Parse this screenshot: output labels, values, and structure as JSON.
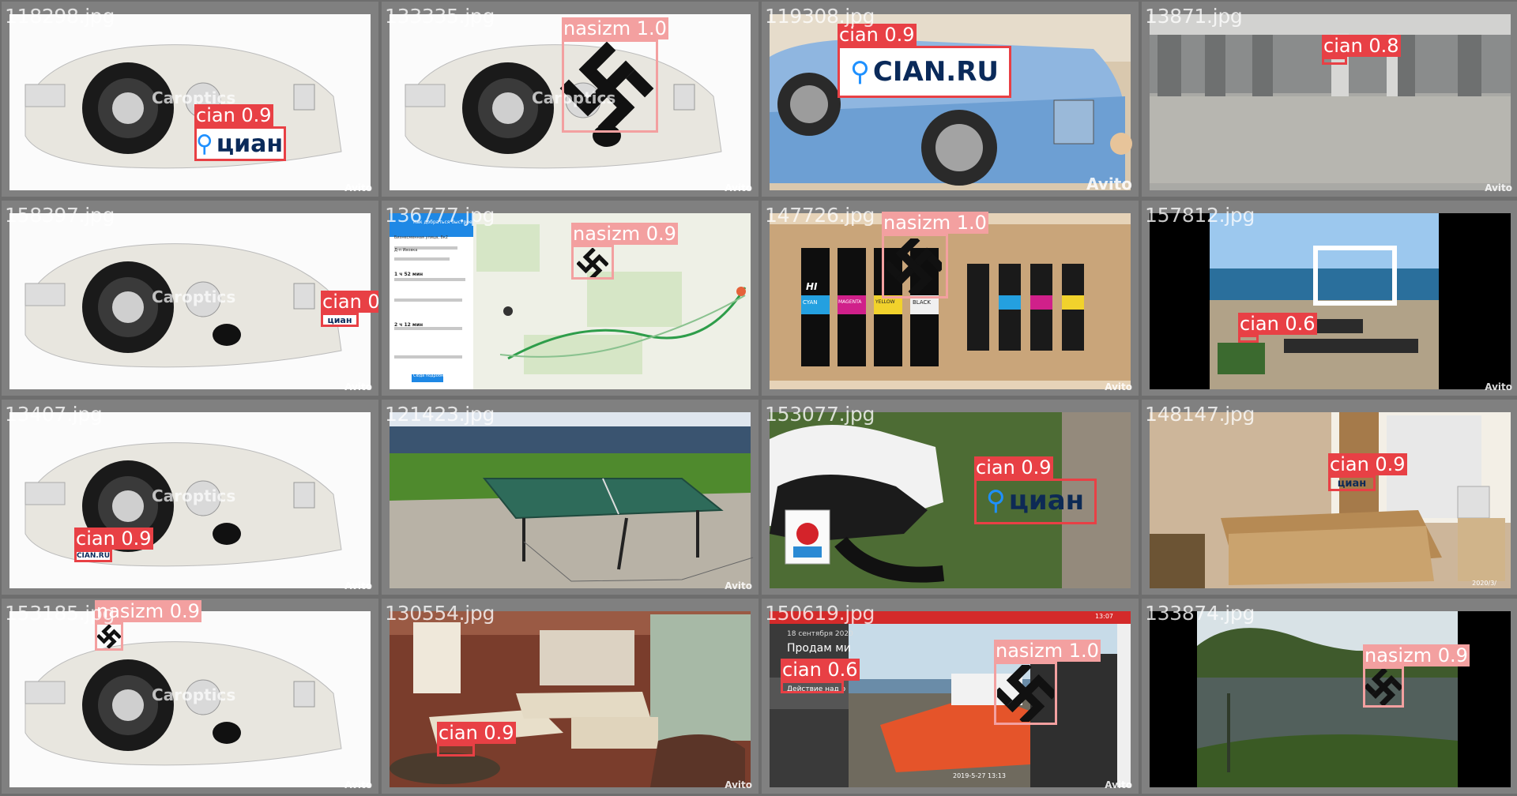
{
  "tiles": [
    {
      "filename": "118298.jpg",
      "scene": "headlight",
      "watermark": "Avito",
      "carparts": "Caroptics",
      "dets": [
        {
          "label": "cian 0.9",
          "cls": "cian"
        }
      ],
      "logo_text": "циан"
    },
    {
      "filename": "133335.jpg",
      "scene": "headlight",
      "watermark": "Avito",
      "carparts": "Caroptics",
      "dets": [
        {
          "label": "nasizm 1.0",
          "cls": "nasizm"
        }
      ]
    },
    {
      "filename": "119308.jpg",
      "scene": "bed",
      "watermark": "Avito",
      "dets": [
        {
          "label": "cian 0.9",
          "cls": "cian"
        }
      ],
      "logo_text": "CIAN.RU"
    },
    {
      "filename": "13871.jpg",
      "scene": "warehouse",
      "watermark": "Avito",
      "dets": [
        {
          "label": "cian 0.8",
          "cls": "cian"
        }
      ]
    },
    {
      "filename": "158397.jpg",
      "scene": "headlight",
      "watermark": "Avito",
      "carparts": "Caroptics",
      "dets": [
        {
          "label": "cian 0.9",
          "cls": "cian"
        }
      ],
      "logo_text": "циан"
    },
    {
      "filename": "136777.jpg",
      "scene": "map",
      "watermark": "",
      "dets": [
        {
          "label": "nasizm 0.9",
          "cls": "nasizm"
        }
      ]
    },
    {
      "filename": "147726.jpg",
      "scene": "ink",
      "watermark": "Avito",
      "dets": [
        {
          "label": "nasizm 1.0",
          "cls": "nasizm"
        }
      ]
    },
    {
      "filename": "157812.jpg",
      "scene": "seaside",
      "watermark": "Avito",
      "dets": [
        {
          "label": "cian 0.6",
          "cls": "cian"
        }
      ]
    },
    {
      "filename": "13407.jpg",
      "scene": "headlight",
      "watermark": "Avito",
      "carparts": "Caroptics",
      "dets": [
        {
          "label": "cian 0.9",
          "cls": "cian"
        }
      ],
      "logo_text": "CIAN.RU"
    },
    {
      "filename": "121423.jpg",
      "scene": "pingpong",
      "watermark": "Avito",
      "dets": []
    },
    {
      "filename": "153077.jpg",
      "scene": "scooter",
      "watermark": "",
      "dets": [
        {
          "label": "cian 0.9",
          "cls": "cian"
        }
      ],
      "logo_text": "циан"
    },
    {
      "filename": "148147.jpg",
      "scene": "bedroom",
      "watermark": "",
      "dets": [
        {
          "label": "cian 0.9",
          "cls": "cian"
        }
      ],
      "logo_text": "циан"
    },
    {
      "filename": "153185.jpg",
      "scene": "headlight",
      "watermark": "Avito",
      "carparts": "Caroptics",
      "dets": [
        {
          "label": "nasizm 0.9",
          "cls": "nasizm"
        }
      ]
    },
    {
      "filename": "130554.jpg",
      "scene": "livingroom",
      "watermark": "Avito",
      "dets": [
        {
          "label": "cian 0.9",
          "cls": "cian"
        }
      ]
    },
    {
      "filename": "150619.jpg",
      "scene": "harvester",
      "watermark": "Avito",
      "dets": [
        {
          "label": "cian 0.6",
          "cls": "cian"
        },
        {
          "label": "nasizm 1.0",
          "cls": "nasizm"
        }
      ],
      "ui_text": "Продам ми",
      "ui_text2": "Действие над о",
      "ui_date": "18 сентября 2020",
      "ui_time": "13:07",
      "ui_stamp": "2019-5-27 13:13"
    },
    {
      "filename": "133874.jpg",
      "scene": "river",
      "watermark": "",
      "dets": [
        {
          "label": "nasizm 0.9",
          "cls": "nasizm"
        }
      ]
    }
  ],
  "extra_text": {
    "map_title": "Как добраться быстрее",
    "map_point_a": "Бизнесменная улица, 8к2",
    "map_point_b": "Д-п Ивовка",
    "map_route1": "1 ч 52 мин",
    "map_route2": "2 ч 12 мин",
    "map_button": "Сюда подробнее",
    "bedroom_stamp": "2020/3/",
    "ink_brand": "HI",
    "ink_labels": [
      "CYAN",
      "MAGENTA",
      "YELLOW",
      "BLACK"
    ]
  },
  "colors": {
    "cian_box": "#e84045",
    "nasizm_box": "#f3a0a0",
    "background": "#6e6e6e"
  }
}
